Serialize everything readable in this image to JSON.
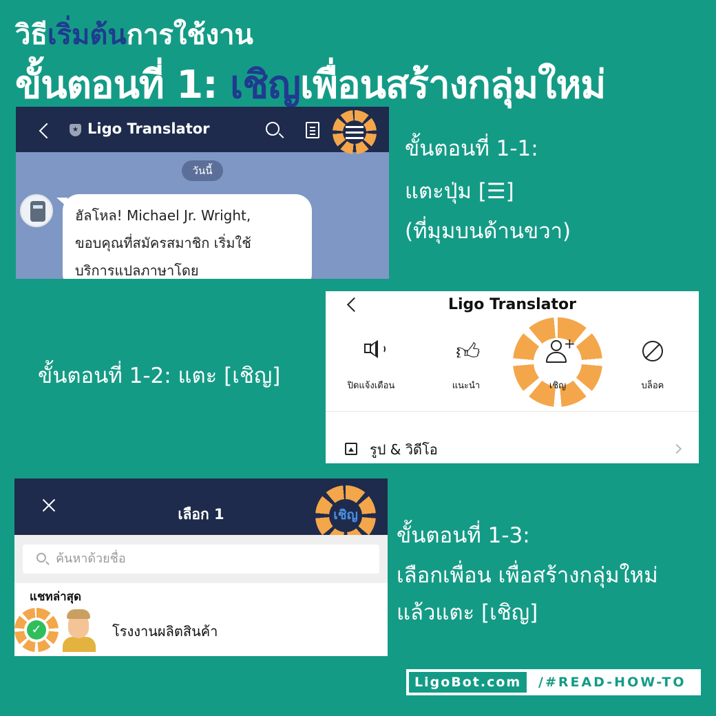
{
  "header": {
    "line1_part1": "วิธี",
    "line1_highlight": "เริ่มต้น",
    "line1_part2": "การใช้งาน",
    "line2_part1": "ขั้นตอนที่ 1: ",
    "line2_highlight": "เชิญ",
    "line2_part2": "เพื่อนสร้างกลุ่มใหม่"
  },
  "panel1": {
    "account_title": "Ligo Translator",
    "date_chip": "วันนี้",
    "message_lines": [
      "ฮัลโหล! Michael Jr. Wright,",
      "ขอบคุณที่สมัครสมาชิก เริ่มใช้",
      "บริการแปลภาษาโดย"
    ],
    "icons": [
      "back-icon",
      "shield-icon",
      "search-icon",
      "notes-icon",
      "menu-icon"
    ]
  },
  "step_1_1": {
    "line1": "ขั้นตอนที่ 1-1:",
    "line2": "แตะปุ่ม [☰]",
    "line3": "(ที่มุมบนด้านขวา)"
  },
  "panel2": {
    "title": "Ligo Translator",
    "actions": [
      {
        "label": "ปิดแจ้งเตือน",
        "icon": "speaker-icon"
      },
      {
        "label": "แนะนำ",
        "icon": "thumbs-up-icon"
      },
      {
        "label": "เชิญ",
        "icon": "add-person-icon"
      },
      {
        "label": "บล็อค",
        "icon": "block-icon"
      }
    ],
    "photo_video_label": "รูป & วิดีโอ"
  },
  "step_1_2": {
    "text": "ขั้นตอนที่ 1-2: แตะ [เชิญ]"
  },
  "panel3": {
    "title": "เลือก 1",
    "invite_button": "เชิญ",
    "search_placeholder": "ค้นหาด้วยชื่อ",
    "recent_header": "แชทล่าสุด",
    "contact_name": "โรงงานผลิตสินค้า",
    "contact_selected": true
  },
  "step_1_3": {
    "line1": "ขั้นตอนที่ 1-3:",
    "line2": "เลือกเพื่อน เพื่อสร้างกลุ่มใหม่",
    "line3": "แล้วแตะ [เชิญ]"
  },
  "footer": {
    "brand": "LigoBot.com",
    "tag": "/#READ-HOW-TO"
  },
  "colors": {
    "background": "#149b86",
    "highlight_text": "#1f3b8f",
    "ring_orange": "#f4a64a",
    "app_bar": "#1e2b4c",
    "chat_bg": "#7e97c4",
    "check_green": "#2fbe5c"
  }
}
